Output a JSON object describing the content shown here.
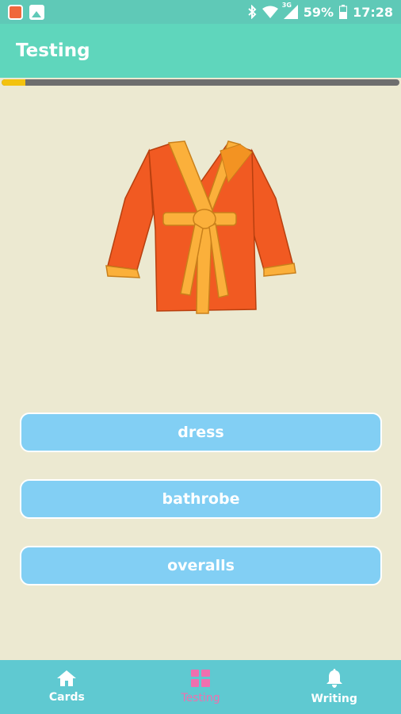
{
  "status_bar": {
    "network": "3G",
    "battery": "59%",
    "time": "17:28"
  },
  "app_bar": {
    "title": "Testing"
  },
  "progress": {
    "value": 0.06,
    "fill_color": "#f3c20e"
  },
  "question": {
    "image": "bathrobe-illustration"
  },
  "answers": [
    {
      "label": "dress"
    },
    {
      "label": "bathrobe"
    },
    {
      "label": "overalls"
    }
  ],
  "bottom_nav": {
    "items": [
      {
        "label": "Cards",
        "icon": "home-icon",
        "active": false
      },
      {
        "label": "Testing",
        "icon": "grid-icon",
        "active": true
      },
      {
        "label": "Writing",
        "icon": "bell-icon",
        "active": false
      }
    ],
    "active_color": "#f06fae"
  },
  "colors": {
    "background": "#ece9d1",
    "header": "#5fd6bc",
    "answer_button": "#82cff4",
    "nav": "#5fc9d1"
  }
}
